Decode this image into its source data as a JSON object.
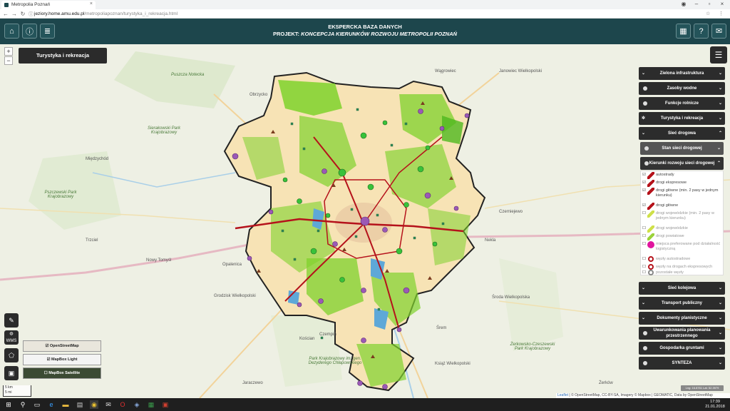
{
  "browser": {
    "tab_title": "Metropolia Poznań",
    "url_host": "jeziory.home.amu.edu.pl",
    "url_path": "/metropoliapoznan/turystyka_i_rekreacja.html"
  },
  "header": {
    "title_line1": "EKSPERCKA BAZA DANYCH",
    "title_line2_prefix": "PROJEKT:",
    "title_line2_em": "KONCEPCJA KIERUNKÓW ROZWOJU METROPOLII POZNAŃ",
    "left_icons": [
      "home-icon",
      "info-icon",
      "database-icon"
    ],
    "right_icons": [
      "map-icon",
      "help-icon",
      "mail-icon"
    ]
  },
  "map": {
    "zoom_in": "+",
    "zoom_out": "−",
    "active_layer": "Turystyka i rekreacja",
    "labels": {
      "puszcza": "Puszcza Notecka",
      "sierakowski": "Sierakowski Park Krajobrazowy",
      "pszczewski": "Pszczewski Park Krajobrazowy",
      "dezydery": "Park Krajobrazowy im. gen. Dezyderego Chłapowskiego",
      "zerkowsko": "Żerkowsko-Czeszewski Park Krajobrazowy",
      "nowy_tomysl": "Nowy Tomyśl",
      "opalenica": "Opalenica",
      "grodzisk": "Grodzisk Wielkopolski",
      "koscian": "Kościan",
      "srem": "Śrem",
      "sroda": "Środa Wielkopolska",
      "czempin": "Czempiń",
      "nekla": "Nekla",
      "czerniejewo": "Czerniejewo",
      "wagrowiec": "Wągrowiec",
      "obrzycko": "Obrzycko",
      "miedzychod": "Międzychód",
      "trzciel": "Trzciel",
      "zerkow": "Żerków",
      "jaraczewo": "Jaraczewo",
      "ksiaz": "Książ Wielkopolski",
      "janowiec": "Janowiec Wielkopolski"
    }
  },
  "panel": {
    "sections": [
      {
        "label": "Zielona infrastruktura"
      },
      {
        "label": "Zasoby wodne"
      },
      {
        "label": "Funkcje rolnicze"
      },
      {
        "label": "Turystyka i rekreacja"
      },
      {
        "label": "Sieć drogowa"
      }
    ],
    "subsections": [
      {
        "label": "Stan sieci drogowej"
      },
      {
        "label": "Kierunki rozwoju sieci drogowej"
      }
    ],
    "legend": [
      {
        "label": "autostrady",
        "checked": true,
        "color": "#b5121b"
      },
      {
        "label": "drogi ekspresowe",
        "checked": true,
        "color": "#b5121b"
      },
      {
        "label": "drogi główne (min. 2 pasy w jednym kierunku)",
        "checked": true,
        "color": "#b5121b"
      },
      {
        "label": "drogi główne",
        "checked": true,
        "color": "#b5121b"
      },
      {
        "label": "drogi wojewódzkie (min. 2 pasy w jednym kierunku)",
        "checked": false,
        "color": "#cfe04a"
      },
      {
        "label": "drogi wojewódzkie",
        "checked": false,
        "color": "#cfe04a"
      },
      {
        "label": "drogi powiatowe",
        "checked": false,
        "color": "#9bd23a"
      },
      {
        "label": "miejsca preferowane pod działalność logistyczną",
        "checked": false,
        "color": "#e0149e"
      },
      {
        "label": "węzły autostradowe",
        "checked": false,
        "color": "#b5121b"
      },
      {
        "label": "węzły na drogach ekspresowych",
        "checked": false,
        "color": "#b5121b"
      },
      {
        "label": "pozostałe węzły",
        "checked": false,
        "color": "#888888"
      }
    ],
    "sections_bottom": [
      {
        "label": "Sieć kolejowa"
      },
      {
        "label": "Transport publiczny"
      },
      {
        "label": "Dokumenty planistyczne"
      },
      {
        "label": "Uwarunkowania planowania przestrzennego"
      },
      {
        "label": "Gospodarka gruntami"
      },
      {
        "label": "SYNTEZA"
      }
    ]
  },
  "tools": {
    "basemaps": [
      {
        "label": "OpenStreetMap",
        "checked": true
      },
      {
        "label": "MapBox Light",
        "checked": true
      },
      {
        "label": "MapBox Satellite",
        "checked": false
      }
    ],
    "wms_label": "WMS",
    "scale_km": "5 km",
    "scale_mi": "5 mi",
    "coords": "Lng: 16.8761 Lat: 52.3979"
  },
  "attribution": {
    "leaflet": "Leaflet",
    "text": "| © OpenStreetMap, CC-BY-SA, Imagery © Mapbox | GEOMATIC, Data by OpenStreetMap"
  },
  "taskbar": {
    "time": "17:39",
    "date": "21.01.2018"
  },
  "colors": {
    "header_bg": "#1d464c",
    "panel_bg": "#2c2c2c",
    "metro_fill": "#f7e3b5",
    "green_zone": "#7fd22c",
    "road_red": "#b5121b",
    "poi_purple": "#9b59b6"
  }
}
